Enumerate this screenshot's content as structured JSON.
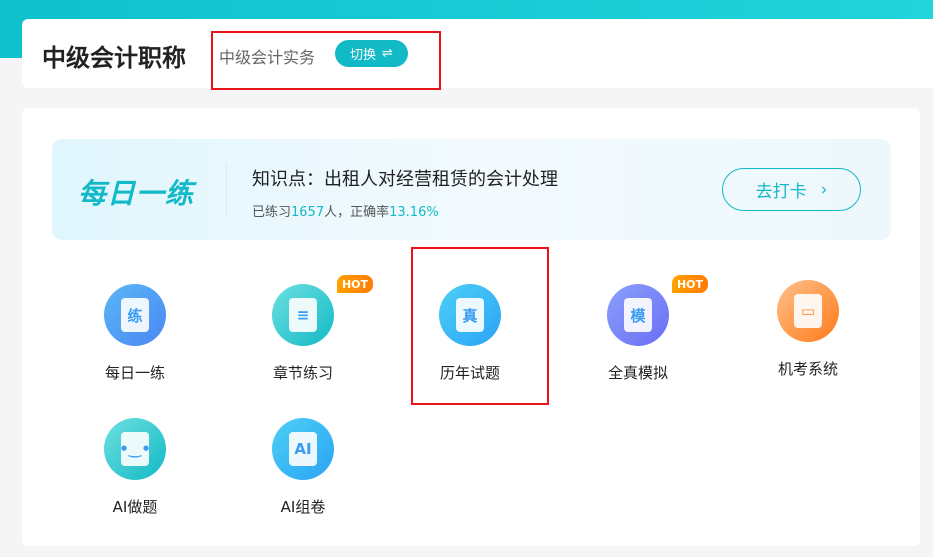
{
  "header": {
    "title": "中级会计职称",
    "subject": "中级会计实务",
    "switch_label": "切换",
    "switch_icon": "⇌"
  },
  "daily": {
    "logo": "每日一练",
    "topic": "知识点：出租人对经营租赁的会计处理",
    "stat_prefix": "已练习",
    "count": "1657",
    "stat_mid": "人，正确率",
    "rate": "13.16%",
    "button": "去打卡",
    "button_icon": "›"
  },
  "items": [
    {
      "label": "每日一练",
      "glyph": "练",
      "hot": ""
    },
    {
      "label": "章节练习",
      "glyph": "≡",
      "hot": "HOT"
    },
    {
      "label": "历年试题",
      "glyph": "真",
      "hot": ""
    },
    {
      "label": "全真模拟",
      "glyph": "模",
      "hot": "HOT"
    },
    {
      "label": "机考系统",
      "glyph": "▭",
      "hot": ""
    },
    {
      "label": "AI做题",
      "glyph": "•‿•",
      "hot": ""
    },
    {
      "label": "AI组卷",
      "glyph": "AI",
      "hot": ""
    }
  ],
  "colors": {
    "accent": "#12b9c6",
    "hot": "#ff8a00",
    "highlight": "#e8141b"
  }
}
